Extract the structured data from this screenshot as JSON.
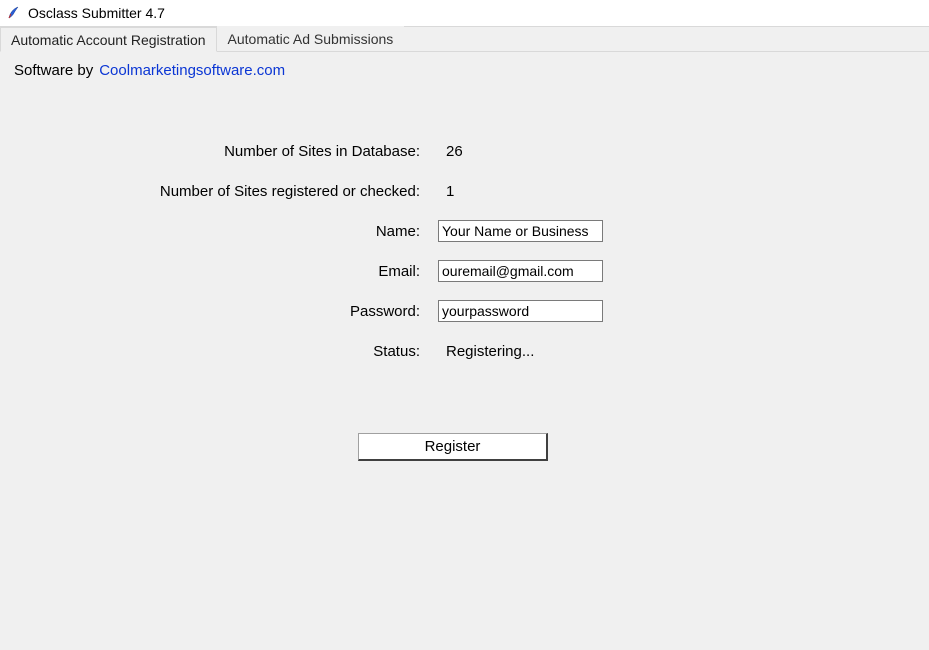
{
  "window": {
    "title": "Osclass Submitter 4.7"
  },
  "tabs": [
    {
      "label": "Automatic Account Registration",
      "active": true
    },
    {
      "label": "Automatic Ad Submissions",
      "active": false
    }
  ],
  "software_by": {
    "prefix": "Software by",
    "link_text": "Coolmarketingsoftware.com"
  },
  "stats": {
    "sites_in_db_label": "Number of Sites in Database:",
    "sites_in_db_value": "26",
    "sites_registered_label": "Number of Sites registered or checked:",
    "sites_registered_value": "1"
  },
  "form": {
    "name_label": "Name:",
    "name_value": "Your Name or Business",
    "email_label": "Email:",
    "email_value": "ouremail@gmail.com",
    "password_label": "Password:",
    "password_value": "yourpassword",
    "status_label": "Status:",
    "status_value": "Registering..."
  },
  "buttons": {
    "register": "Register"
  }
}
